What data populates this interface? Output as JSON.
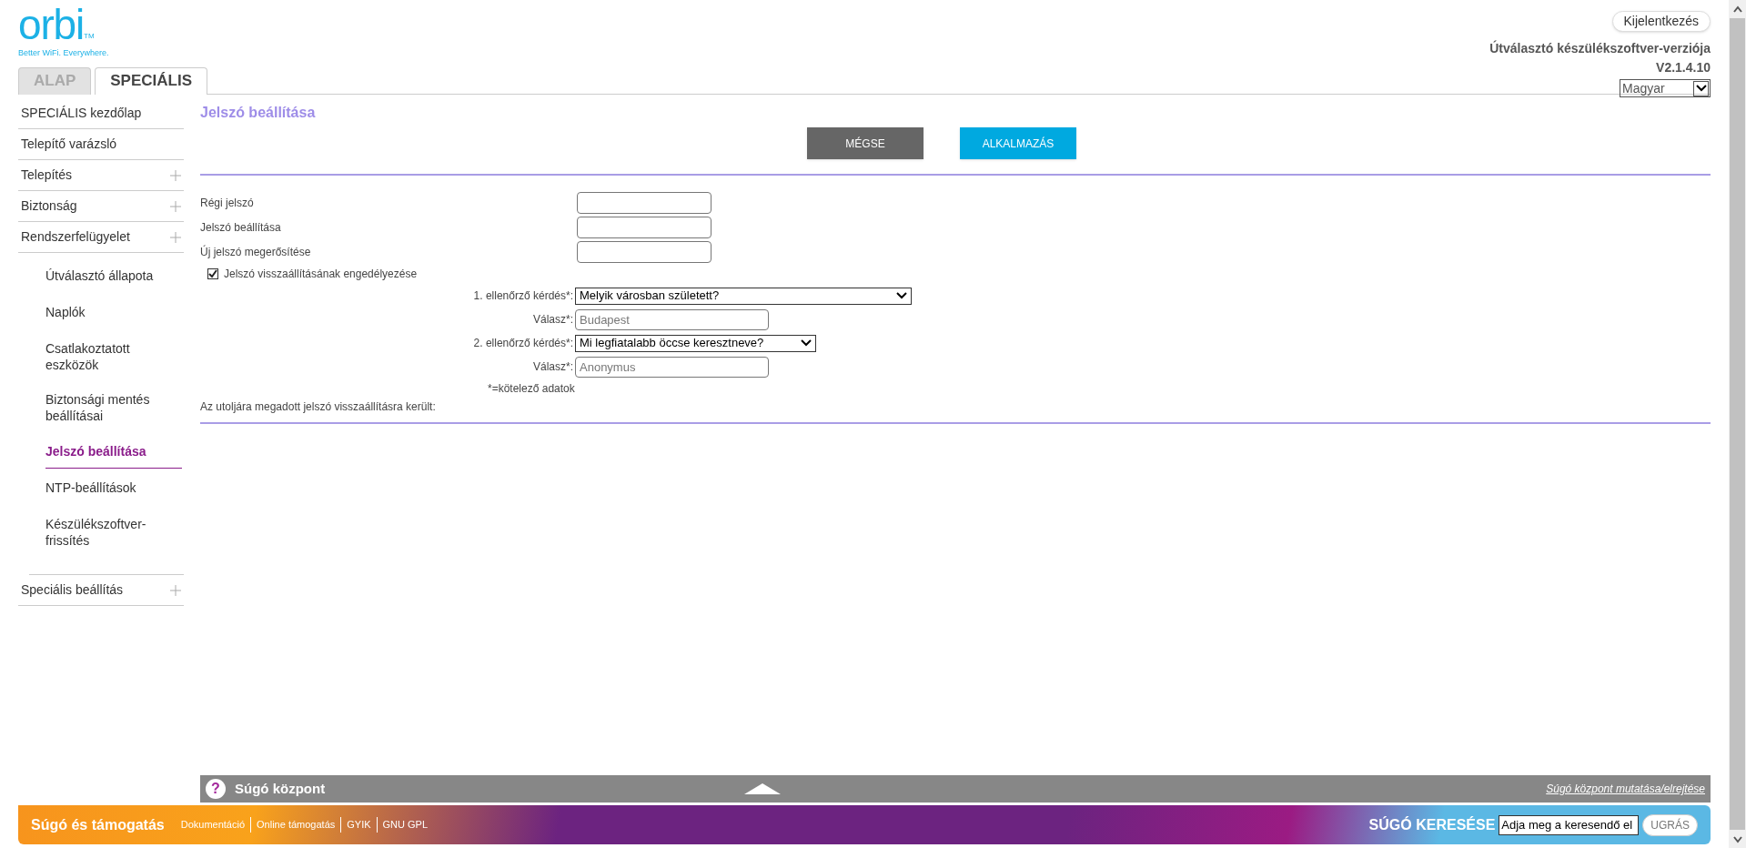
{
  "logo": {
    "name": "orbi",
    "tm": "TM",
    "tagline": "Better WiFi. Everywhere."
  },
  "tabs": [
    {
      "label": "ALAP",
      "selected": false
    },
    {
      "label": "SPECIÁLIS",
      "selected": true
    }
  ],
  "header": {
    "logout": "Kijelentkezés",
    "firmware_label": "Útválasztó készülékszoftver-verziója",
    "firmware_version": "V2.1.4.10",
    "language": "Magyar"
  },
  "sidebar": {
    "items": [
      {
        "label": "SPECIÁLIS kezdőlap",
        "expandable": false
      },
      {
        "label": "Telepítő varázsló",
        "expandable": false
      },
      {
        "label": "Telepítés",
        "expandable": true
      },
      {
        "label": "Biztonság",
        "expandable": true
      },
      {
        "label": "Rendszerfelügyelet",
        "expandable": true,
        "children": [
          {
            "label": "Útválasztó állapota",
            "selected": false
          },
          {
            "label": "Naplók",
            "selected": false
          },
          {
            "label": "Csatlakoztatott eszközök",
            "selected": false
          },
          {
            "label": "Biztonsági mentés beállításai",
            "selected": false
          },
          {
            "label": "Jelszó beállítása",
            "selected": true
          },
          {
            "label": "NTP-beállítások",
            "selected": false
          },
          {
            "label": "Készülékszoftver-frissítés",
            "selected": false
          }
        ]
      },
      {
        "label": "Speciális beállítás",
        "expandable": true
      }
    ]
  },
  "page": {
    "title": "Jelszó beállítása",
    "buttons": [
      {
        "label": "MÉGSE",
        "kind": "cancel"
      },
      {
        "label": "ALKALMAZÁS",
        "kind": "apply"
      }
    ],
    "password_fields": [
      {
        "label": "Régi jelszó"
      },
      {
        "label": "Jelszó beállítása"
      },
      {
        "label": "Új jelszó megerősítése"
      }
    ],
    "recovery": {
      "label": "Jelszó visszaállításának engedélyezése",
      "checked": true
    },
    "security_rows": [
      {
        "kind": "question",
        "label": "1. ellenőrző kérdés*:",
        "value": "Melyik városban született?"
      },
      {
        "kind": "answer",
        "label": "Válasz*:",
        "value": "Budapest"
      },
      {
        "kind": "question",
        "label": "2. ellenőrző kérdés*:",
        "value": "Mi legfiatalabb öccse keresztneve?"
      },
      {
        "kind": "answer",
        "label": "Válasz*:",
        "value": "Anonymus"
      }
    ],
    "required_note": "*=kötelező adatok",
    "status_note": "Az utoljára megadott jelszó visszaállításra került:"
  },
  "help_center": {
    "icon": "?",
    "title": "Súgó központ",
    "toggle_link": "Súgó központ mutatása/elrejtése"
  },
  "support": {
    "title": "Súgó és támogatás",
    "links": [
      "Dokumentáció",
      "Online támogatás",
      "GYIK",
      "GNU GPL"
    ],
    "search_label": "SÚGÓ KERESÉSE",
    "search_value": "Adja meg a keresendő el",
    "go": "UGRÁS"
  }
}
